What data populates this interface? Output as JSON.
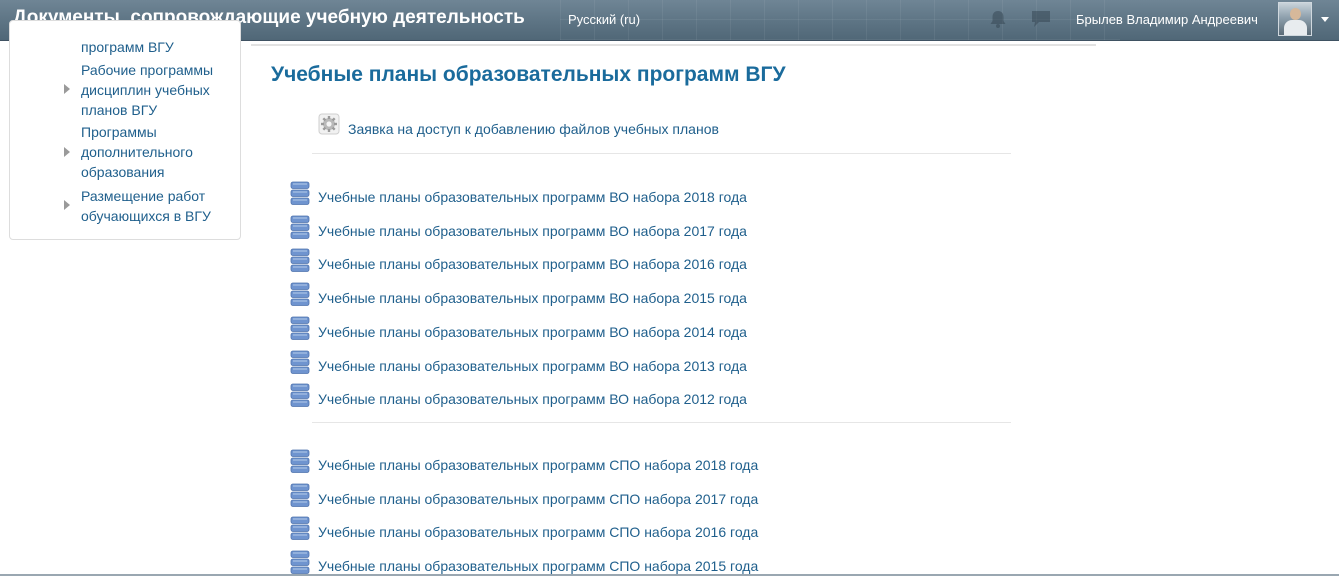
{
  "header": {
    "site_title": "Документы, сопровождающие учебную деятельность",
    "language": "Русский (ru)",
    "user_name": "Брылев Владимир Андреевич",
    "icons": [
      "notification-bell-icon",
      "messages-icon",
      "user-avatar",
      "user-menu-caret-icon"
    ]
  },
  "sidebar": {
    "items": [
      {
        "label": "программ ВГУ",
        "has_arrow": false
      },
      {
        "label": "Рабочие программы дисциплин учебных планов ВГУ",
        "has_arrow": true
      },
      {
        "label": "Программы дополнительного образования",
        "has_arrow": true
      },
      {
        "label": "Размещение работ обучающихся в ВГУ",
        "has_arrow": true
      }
    ]
  },
  "main": {
    "title": "Учебные планы образовательных программ ВГУ",
    "request_link": "Заявка на доступ к добавлению файлов учебных планов",
    "vo_plans": [
      "Учебные планы образовательных программ ВО набора 2018 года",
      "Учебные планы образовательных программ ВО набора 2017 года",
      "Учебные планы образовательных программ ВО набора 2016 года",
      "Учебные планы образовательных программ ВО набора 2015 года",
      "Учебные планы образовательных программ ВО набора 2014 года",
      "Учебные планы образовательных программ ВО набора 2013 года",
      "Учебные планы образовательных программ ВО набора 2012 года"
    ],
    "spo_plans": [
      "Учебные планы образовательных программ СПО набора 2018 года",
      "Учебные планы образовательных программ СПО набора 2017 года",
      "Учебные планы образовательных программ СПО набора 2016 года",
      "Учебные планы образовательных программ СПО набора 2015 года"
    ]
  },
  "colors": {
    "navbar": "#5d7484",
    "link": "#1f5f8c",
    "title": "#1a6b9c",
    "icon_blue": "#6f94cf"
  }
}
